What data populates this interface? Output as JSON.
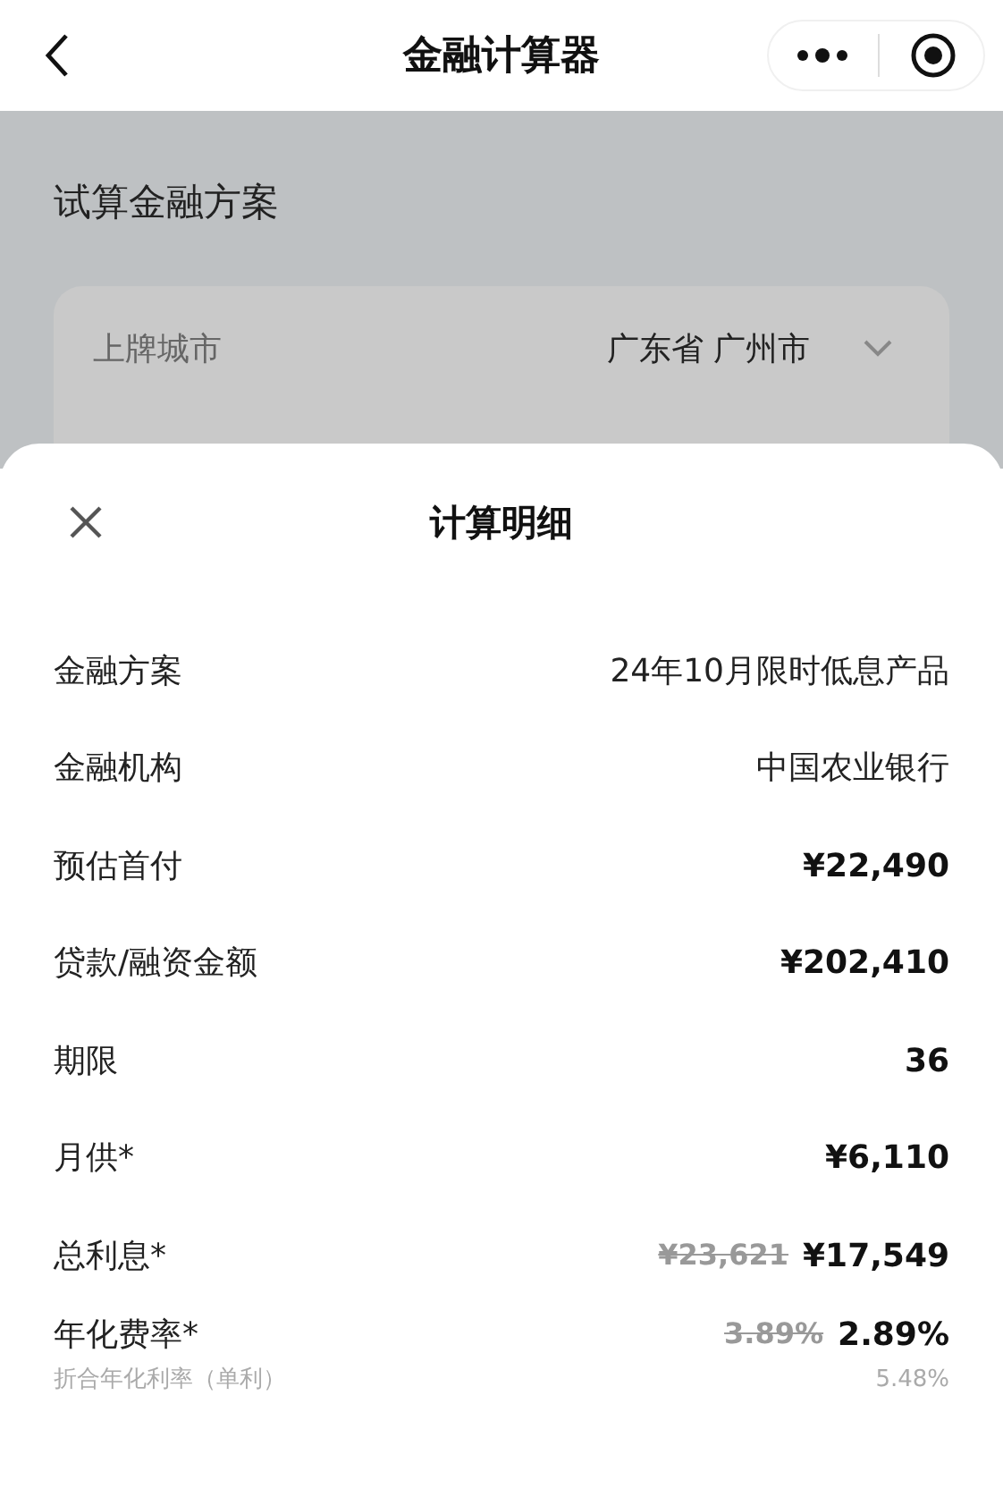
{
  "nav_bar": {
    "title": "金融计算器"
  },
  "background": {
    "section_title": "试算金融方案",
    "field": {
      "label": "上牌城市",
      "value": "广东省 广州市"
    }
  },
  "sheet": {
    "title": "计算明细",
    "rows": [
      {
        "label": "金融方案",
        "value": "24年10月限时低息产品",
        "bold": false
      },
      {
        "label": "金融机构",
        "value": "中国农业银行",
        "bold": false
      },
      {
        "label": "预估首付",
        "value": "¥22,490",
        "bold": true
      },
      {
        "label": "贷款/融资金额",
        "value": "¥202,410",
        "bold": true
      },
      {
        "label": "期限",
        "value": "36",
        "bold": true
      },
      {
        "label": "月供*",
        "value": "¥6,110",
        "bold": true
      },
      {
        "label": "总利息*",
        "original_value": "¥23,621",
        "value": "¥17,549",
        "bold": true
      },
      {
        "label": "年化费率*",
        "original_value": "3.89%",
        "value": "2.89%",
        "bold": true,
        "note": "折合年化利率（单利）",
        "note_value": "5.48%"
      }
    ]
  }
}
